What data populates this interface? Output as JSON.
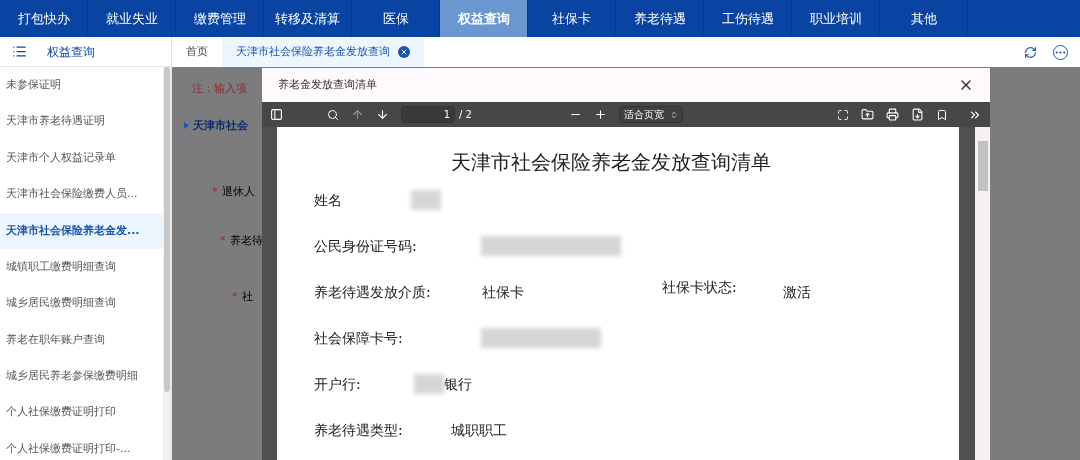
{
  "nav": [
    {
      "label": "打包快办",
      "selected": false
    },
    {
      "label": "就业失业",
      "selected": false
    },
    {
      "label": "缴费管理",
      "selected": false
    },
    {
      "label": "转移及清算",
      "selected": false
    },
    {
      "label": "医保",
      "selected": false
    },
    {
      "label": "权益查询",
      "selected": true
    },
    {
      "label": "社保卡",
      "selected": false
    },
    {
      "label": "养老待遇",
      "selected": false
    },
    {
      "label": "工伤待遇",
      "selected": false
    },
    {
      "label": "职业培训",
      "selected": false
    },
    {
      "label": "其他",
      "selected": false
    }
  ],
  "sidebar": {
    "title": "权益查询",
    "items": [
      {
        "label": "未参保证明",
        "selected": false
      },
      {
        "label": "天津市养老待遇证明",
        "selected": false
      },
      {
        "label": "天津市个人权益记录单",
        "selected": false
      },
      {
        "label": "天津市社会保险缴费人员...",
        "selected": false
      },
      {
        "label": "天津市社会保险养老金发...",
        "selected": true
      },
      {
        "label": "城镇职工缴费明细查询",
        "selected": false
      },
      {
        "label": "城乡居民缴费明细查询",
        "selected": false
      },
      {
        "label": "养老在职年账户查询",
        "selected": false
      },
      {
        "label": "城乡居民养老参保缴费明细",
        "selected": false
      },
      {
        "label": "个人社保缴费证明打印",
        "selected": false
      },
      {
        "label": "个人社保缴费证明打印-...",
        "selected": false
      }
    ]
  },
  "tabs": [
    {
      "label": "首页",
      "selected": false,
      "closable": false
    },
    {
      "label": "天津市社会保险养老金发放查询",
      "selected": true,
      "closable": true
    }
  ],
  "form_behind": {
    "note": "注：输入项",
    "section": "天津市社会",
    "fields": [
      {
        "mark": "*",
        "label": "退休人"
      },
      {
        "mark": "*",
        "label": "养老待"
      },
      {
        "mark": "*",
        "label": "社"
      }
    ]
  },
  "dialog": {
    "title": "养老金发放查询清单",
    "toolbar": {
      "page": "1",
      "page_count": "/ 2",
      "zoom": "适合页宽"
    },
    "document": {
      "title": "天津市社会保险养老金发放查询清单",
      "rows": [
        {
          "label": "姓名",
          "redacted": true
        },
        {
          "label": "公民身份证号码:",
          "redacted": true
        },
        {
          "label": "养老待遇发放介质:",
          "value": "社保卡",
          "extra_label": "社保卡状态:",
          "extra_value": "激活"
        },
        {
          "label": "社会保障卡号:",
          "redacted": true
        },
        {
          "label": "开户行:",
          "redacted": true,
          "value": "银行"
        },
        {
          "label": "养老待遇类型:",
          "value": "城职职工"
        }
      ]
    }
  }
}
